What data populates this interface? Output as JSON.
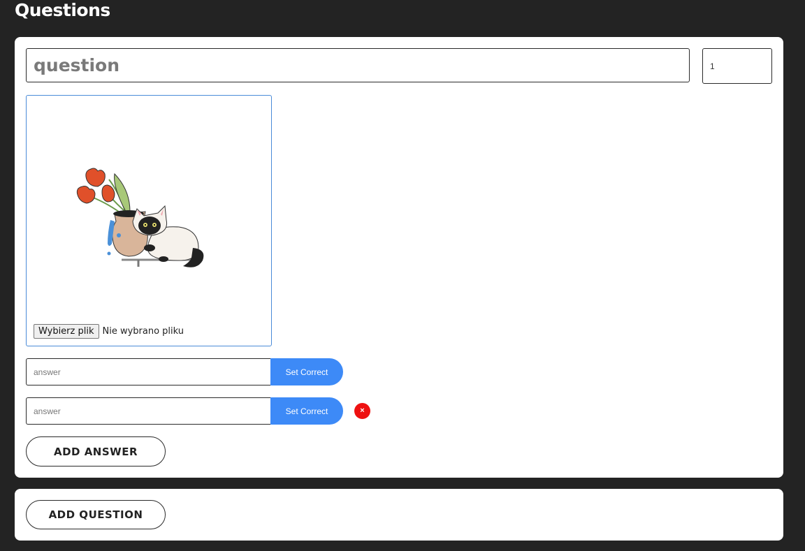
{
  "page": {
    "title": "Questions"
  },
  "question": {
    "placeholder": "question",
    "points_value": "1"
  },
  "image_upload": {
    "choose_label": "Wybierz plik",
    "status": "Nie wybrano pliku",
    "image_icon": "cat-vase-illustration"
  },
  "answers": [
    {
      "placeholder": "answer",
      "set_correct_label": "Set Correct"
    },
    {
      "placeholder": "answer",
      "set_correct_label": "Set Correct",
      "remove_icon": "×"
    }
  ],
  "buttons": {
    "add_answer": "ADD ANSWER",
    "add_question": "ADD QUESTION"
  },
  "colors": {
    "background": "#232323",
    "card": "#ffffff",
    "accent_blue": "#3d8af7",
    "remove_red": "#ee1111",
    "image_border": "#4a8bd8"
  }
}
